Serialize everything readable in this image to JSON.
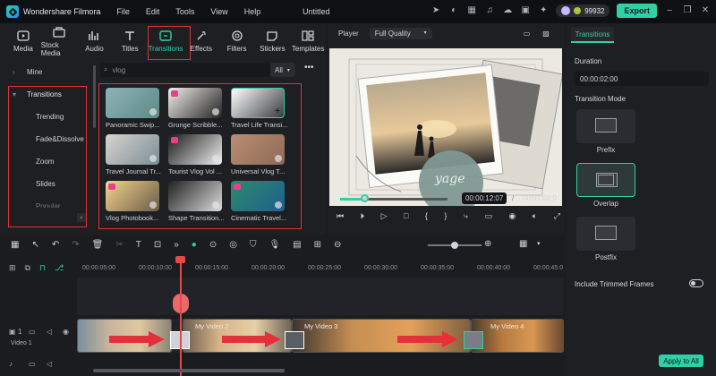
{
  "app": {
    "name": "Wondershare Filmora",
    "doc_title": "Untitled",
    "menu": [
      "File",
      "Edit",
      "Tools",
      "View",
      "Help"
    ],
    "credits": "99932",
    "export_label": "Export"
  },
  "categories": [
    {
      "label": "Media",
      "icon": "media-icon"
    },
    {
      "label": "Stock Media",
      "icon": "stock-media-icon"
    },
    {
      "label": "Audio",
      "icon": "audio-icon"
    },
    {
      "label": "Titles",
      "icon": "titles-icon"
    },
    {
      "label": "Transitions",
      "icon": "transitions-icon",
      "active": true
    },
    {
      "label": "Effects",
      "icon": "effects-icon"
    },
    {
      "label": "Filters",
      "icon": "filters-icon"
    },
    {
      "label": "Stickers",
      "icon": "stickers-icon"
    },
    {
      "label": "Templates",
      "icon": "templates-icon"
    }
  ],
  "sidebar": {
    "mine": "Mine",
    "section": "Transitions",
    "items": [
      "Trending",
      "Fade&Dissolve",
      "Zoom",
      "Slides",
      "Popular"
    ]
  },
  "search": {
    "value": "vlog",
    "filter": "All"
  },
  "cards": [
    {
      "label": "Panoramic Swip...",
      "colors": [
        "#8fb3b8",
        "#5c8a86"
      ]
    },
    {
      "label": "Grunge Scribble...",
      "colors": [
        "#f2f0ec",
        "#222"
      ],
      "badge": true
    },
    {
      "label": "Travel Life Transi...",
      "colors": [
        "#ffffff",
        "#3a3c40"
      ],
      "selected": true
    },
    {
      "label": "Travel Journal Tr...",
      "colors": [
        "#d8d4cf",
        "#7a8d95"
      ]
    },
    {
      "label": "Tourist Vlog Vol ...",
      "colors": [
        "#1b1b1b",
        "#f0f0f0"
      ],
      "badge": true
    },
    {
      "label": "Universal Vlog T...",
      "colors": [
        "#b98e73",
        "#8e6a57"
      ]
    },
    {
      "label": "Vlog Photobook...",
      "colors": [
        "#f3d58a",
        "#6b5a4a"
      ],
      "badge": true
    },
    {
      "label": "Shape Transition...",
      "colors": [
        "#202020",
        "#dcdcdc"
      ]
    },
    {
      "label": "Cinematic Travel...",
      "colors": [
        "#2c8a6a",
        "#1f5f8f"
      ],
      "badge": true
    }
  ],
  "player": {
    "label": "Player",
    "quality": "Full Quality",
    "current": "00:00:12:07",
    "total": "00:01:02:0"
  },
  "props": {
    "tab": "Transitions",
    "duration_label": "Duration",
    "duration": "00:00:02:00",
    "mode_label": "Transition Mode",
    "modes": [
      "Prefix",
      "Overlap",
      "Postfix"
    ],
    "trimmed": "Include Trimmed Frames",
    "apply": "Apply to All"
  },
  "ruler": [
    "00:00:05:00",
    "00:00:10:00",
    "00:00:15:00",
    "00:00:20:00",
    "00:00:25:00",
    "00:00:30:00",
    "00:00:35:00",
    "00:00:40:00",
    "00:00:45:0"
  ],
  "clips": [
    {
      "name": "My Video 2"
    },
    {
      "name": "My Video 3"
    },
    {
      "name": "My Video 4"
    }
  ],
  "track": {
    "label": "Video 1",
    "index": "1"
  }
}
